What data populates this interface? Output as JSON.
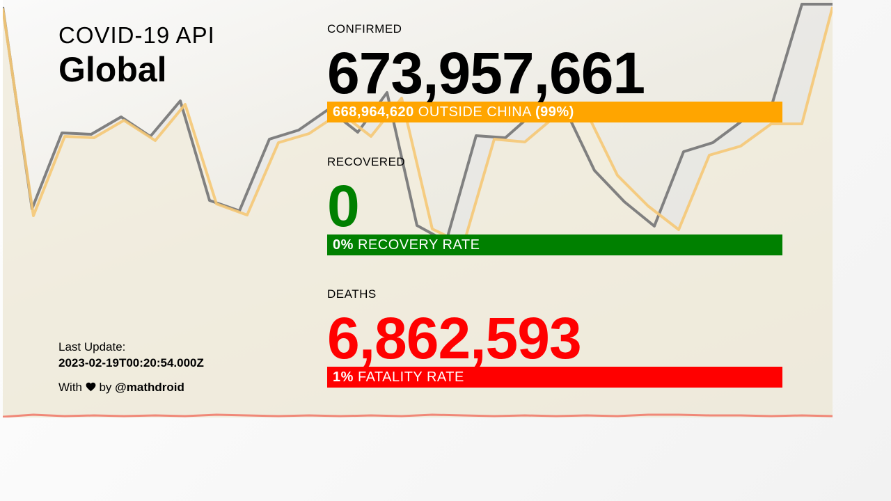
{
  "header": {
    "api_title": "COVID-19 API",
    "scope": "Global"
  },
  "update": {
    "label": "Last Update:",
    "timestamp": "2023-02-19T00:20:54.000Z"
  },
  "credit": {
    "with": "With",
    "by": "by",
    "author": "@mathdroid",
    "icon": "heart-icon"
  },
  "confirmed": {
    "label": "CONFIRMED",
    "value": "673,957,661",
    "bar_value": "668,964,620",
    "bar_text": "OUTSIDE CHINA",
    "bar_percent": "(99%)",
    "color": "#ffa500"
  },
  "recovered": {
    "label": "RECOVERED",
    "value": "0",
    "bar_value": "0%",
    "bar_text": "RECOVERY RATE",
    "color": "#008000"
  },
  "deaths": {
    "label": "DEATHS",
    "value": "6,862,593",
    "bar_value": "1%",
    "bar_text": "FATALITY RATE",
    "color": "#ff0000"
  },
  "colors": {
    "grey_line": "#808080",
    "orange_line": "#f5c876",
    "red_line": "#f08878"
  }
}
